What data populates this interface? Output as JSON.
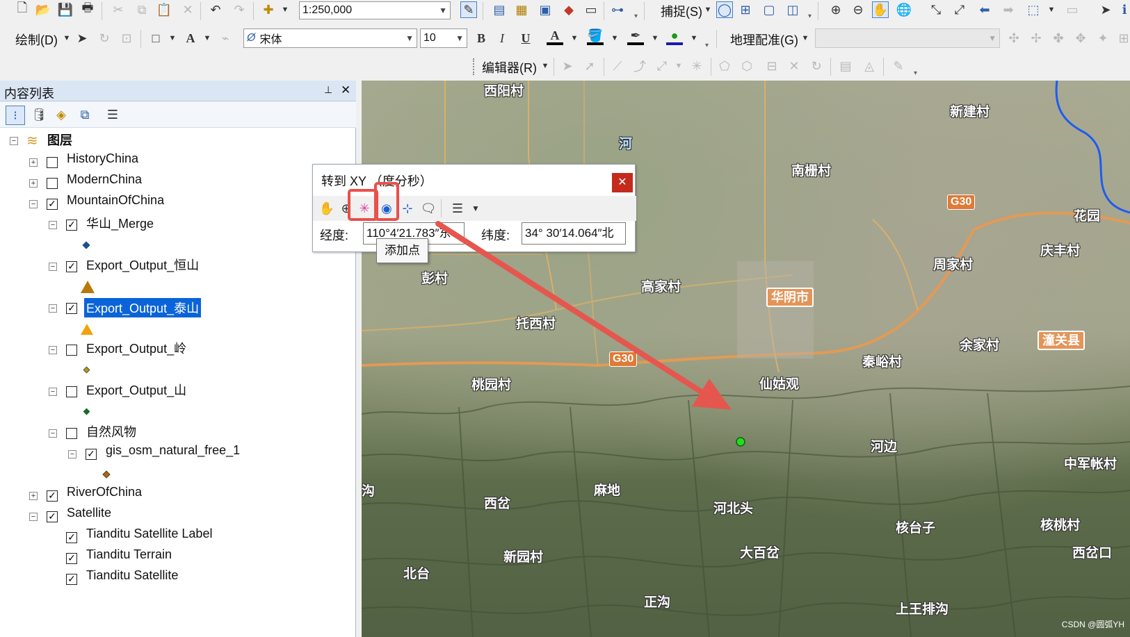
{
  "toolbar": {
    "scale": "1:250,000",
    "snap_label": "捕捉(S)",
    "draw_label": "绘制(D)",
    "font_name": "宋体",
    "font_size": "10",
    "georef_label": "地理配准(G)",
    "editor_label": "编辑器(R)",
    "bold": "B",
    "italic": "I",
    "underline": "U",
    "text_tool": "A"
  },
  "toc": {
    "title": "内容列表",
    "pin": "📌",
    "close": "✕",
    "root_label": "图层",
    "layers": [
      {
        "label": "HistoryChina",
        "checked": false
      },
      {
        "label": "ModernChina",
        "checked": false
      },
      {
        "label": "MountainOfChina",
        "checked": true
      },
      {
        "label": "华山_Merge",
        "checked": true
      },
      {
        "label": "Export_Output_恒山",
        "checked": true
      },
      {
        "label": "Export_Output_泰山",
        "checked": true
      },
      {
        "label": "Export_Output_岭",
        "checked": false
      },
      {
        "label": "Export_Output_山",
        "checked": false
      },
      {
        "label": "自然风物",
        "checked": false
      },
      {
        "label": "gis_osm_natural_free_1",
        "checked": true
      },
      {
        "label": "RiverOfChina",
        "checked": true
      },
      {
        "label": "Satellite",
        "checked": true
      },
      {
        "label": "Tianditu Satellite Label",
        "checked": true
      },
      {
        "label": "Tianditu Terrain",
        "checked": true
      },
      {
        "label": "Tianditu Satellite",
        "checked": true
      }
    ]
  },
  "dialog": {
    "title": "转到 XY （度分秒）",
    "close": "✕",
    "lon_label": "经度:",
    "lon_value": "110°4′21.783″东",
    "lat_label": "纬度:",
    "lat_value": "34° 30′14.064″北",
    "tooltip": "添加点"
  },
  "map": {
    "places": [
      "西阳村",
      "新建村",
      "南栅村",
      "花园",
      "庆丰村",
      "周家村",
      "彭村",
      "高家村",
      "华阴市",
      "托西村",
      "余家村",
      "潼关县",
      "秦峪村",
      "桃园村",
      "仙姑观",
      "河边",
      "中军帐村",
      "西岔",
      "麻地",
      "河北头",
      "核台子",
      "核桃村",
      "新园村",
      "大百岔",
      "西岔口",
      "北台",
      "正沟",
      "上王排沟",
      "河",
      "沟"
    ],
    "highway": "G30"
  },
  "watermark": "CSDN @圆弧YH"
}
